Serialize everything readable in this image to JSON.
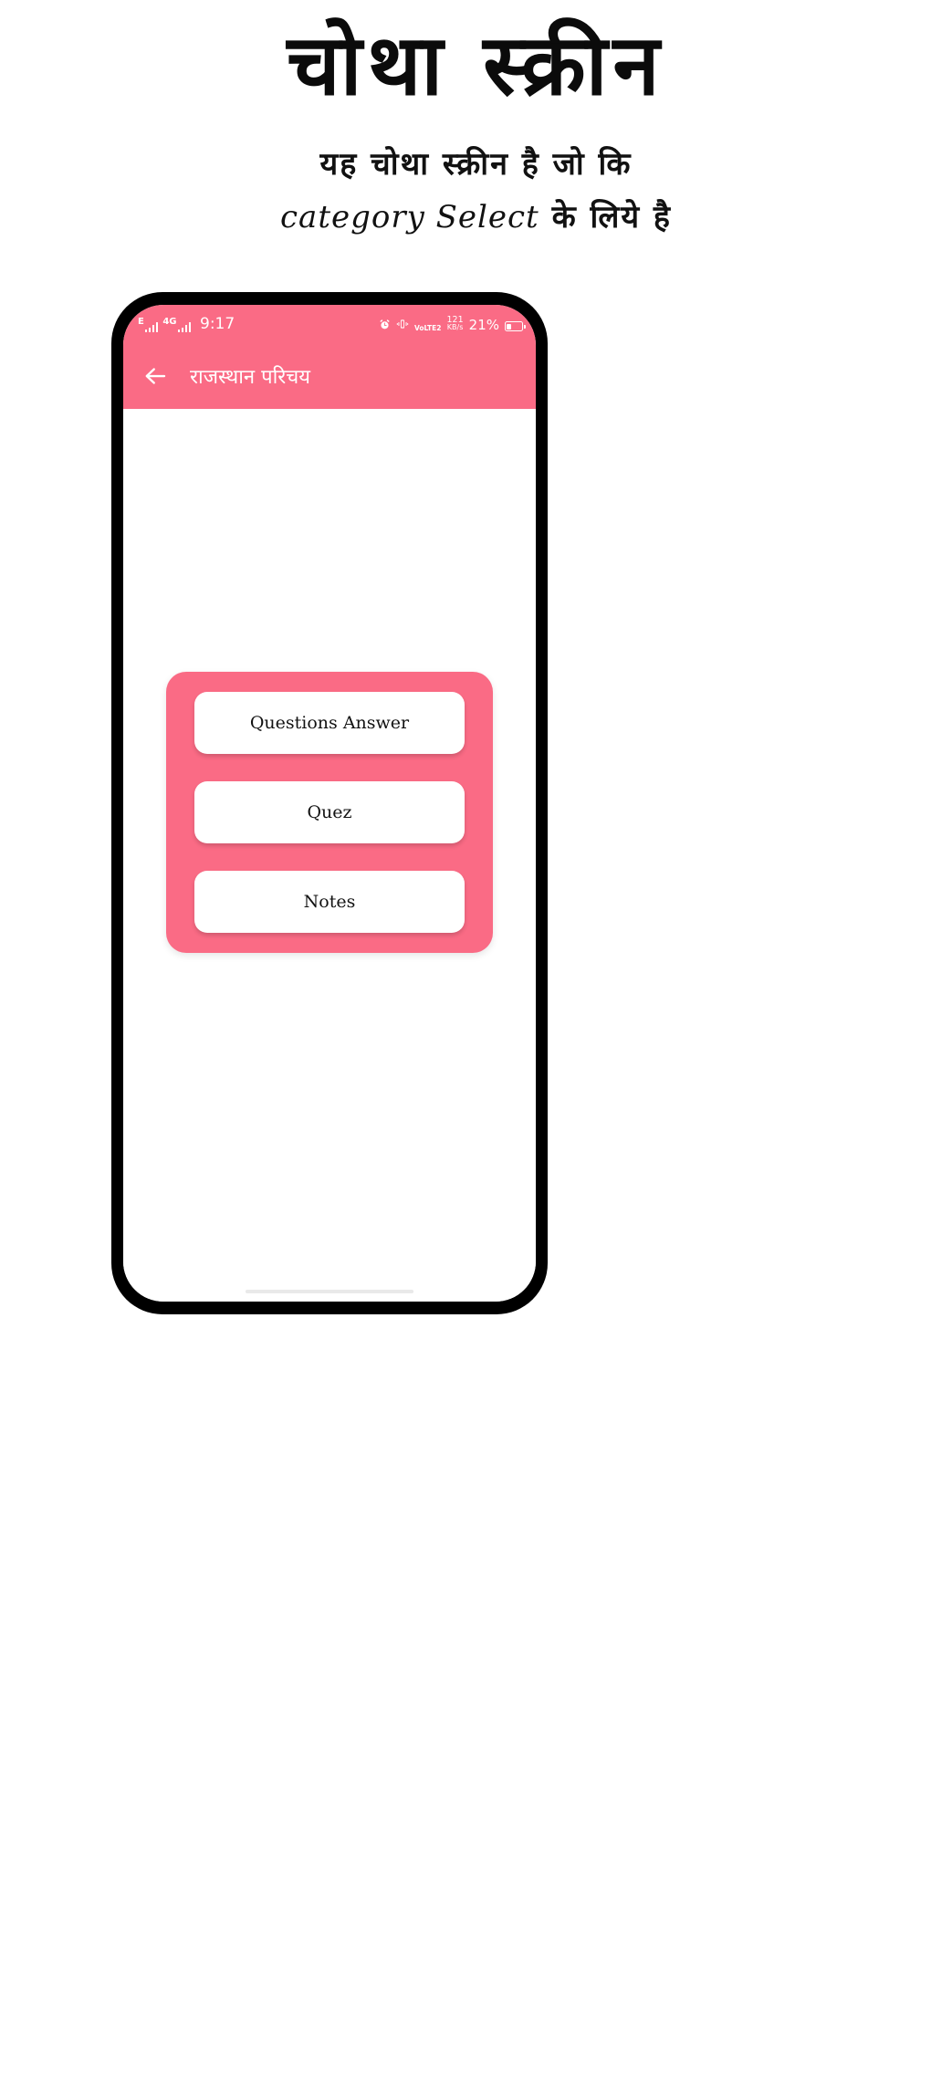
{
  "poster": {
    "title": "चोथा स्क्रीन",
    "subtitle_line1": "यह चोथा स्क्रीन है जो कि",
    "subtitle_line2_handwritten": "category Select",
    "subtitle_line2_rest": "के लिये है"
  },
  "theme": {
    "accent_pink": "#FA6B85",
    "screen_background": "#FFFFFF",
    "frame_black": "#000000",
    "card_text": "#121212"
  },
  "phone": {
    "status_bar": {
      "network_type_1": "E",
      "network_type_2": "4G",
      "time": "9:17",
      "alarm_icon": "alarm-clock-icon",
      "vibrate_icon": "vibrate-icon",
      "volte_label": "VoLTE2",
      "network_speed_value": "121",
      "network_speed_unit": "KB/s",
      "battery_percent": "21%"
    },
    "app_bar": {
      "back_icon": "arrow-left-icon",
      "title": "राजस्थान परिचय"
    },
    "menu": {
      "items": [
        {
          "label": "Questions Answer"
        },
        {
          "label": "Quez"
        },
        {
          "label": "Notes"
        }
      ]
    }
  }
}
